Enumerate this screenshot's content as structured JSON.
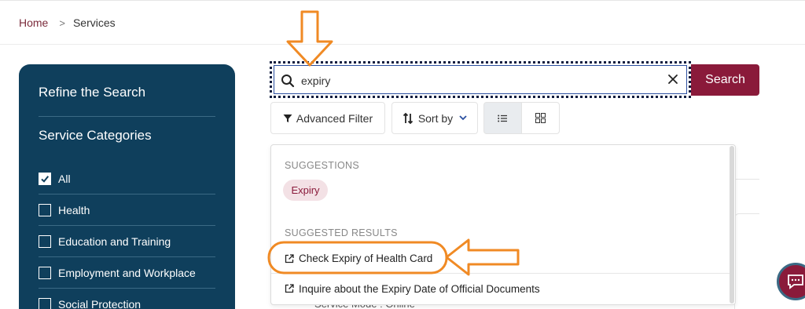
{
  "breadcrumb": {
    "home": "Home",
    "separator": ">",
    "current": "Services"
  },
  "sidebar": {
    "title": "Refine the Search",
    "categories_title": "Service Categories",
    "items": [
      {
        "label": "All",
        "checked": true
      },
      {
        "label": "Health",
        "checked": false
      },
      {
        "label": "Education and Training",
        "checked": false
      },
      {
        "label": "Employment and Workplace",
        "checked": false
      },
      {
        "label": "Social Protection",
        "checked": false
      }
    ]
  },
  "search": {
    "value": "expiry",
    "button_label": "Search"
  },
  "toolbar": {
    "advanced_filter": "Advanced Filter",
    "sort_by": "Sort by"
  },
  "dropdown": {
    "suggestions_heading": "SUGGESTIONS",
    "suggestion_chip": "Expiry",
    "results_heading": "SUGGESTED RESULTS",
    "results": [
      {
        "label": "Check Expiry of Health Card"
      },
      {
        "label": "Inquire about the Expiry Date of Official Documents"
      }
    ]
  },
  "background": {
    "partial_text": "Service Mode : Online"
  },
  "colors": {
    "primary": "#8a1a3a",
    "sidebar": "#0f3f5c",
    "annotation": "#f08a24",
    "search_focus": "#0d1b3e"
  },
  "icons": [
    "search-icon",
    "close-icon",
    "filter-icon",
    "sort-icon",
    "chevron-down-icon",
    "list-view-icon",
    "grid-view-icon",
    "external-link-icon",
    "chat-icon"
  ]
}
